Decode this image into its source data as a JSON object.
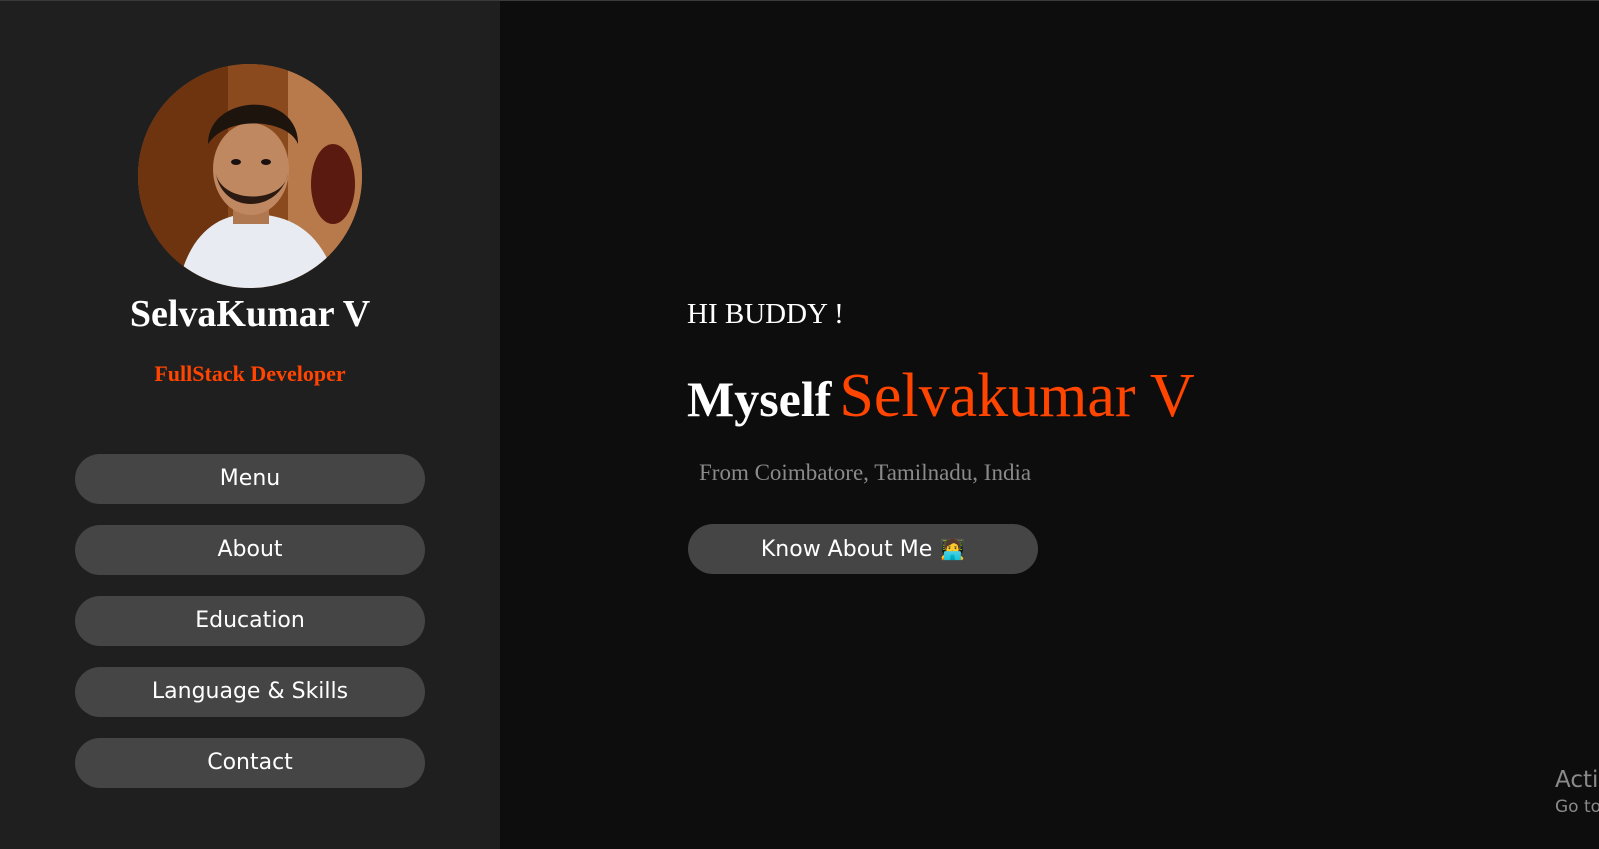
{
  "sidebar": {
    "profile": {
      "name": "SelvaKumar V",
      "role": "FullStack Developer"
    },
    "nav": [
      {
        "label": "Menu"
      },
      {
        "label": "About"
      },
      {
        "label": "Education"
      },
      {
        "label": "Language & Skills"
      },
      {
        "label": "Contact"
      }
    ]
  },
  "hero": {
    "greeting": "HI BUDDY !",
    "intro": "Myself",
    "name": "Selvakumar V",
    "location": "From Coimbatore, Tamilnadu, India",
    "cta_label": "Know About Me",
    "cta_emoji": "🧑‍💻"
  },
  "watermark": {
    "line1": "Activ",
    "line2": "Go to"
  },
  "colors": {
    "accent": "#ff4500",
    "sidebar_bg": "#1f1f1f",
    "main_bg": "#0d0d0d",
    "button_bg": "#454545"
  }
}
